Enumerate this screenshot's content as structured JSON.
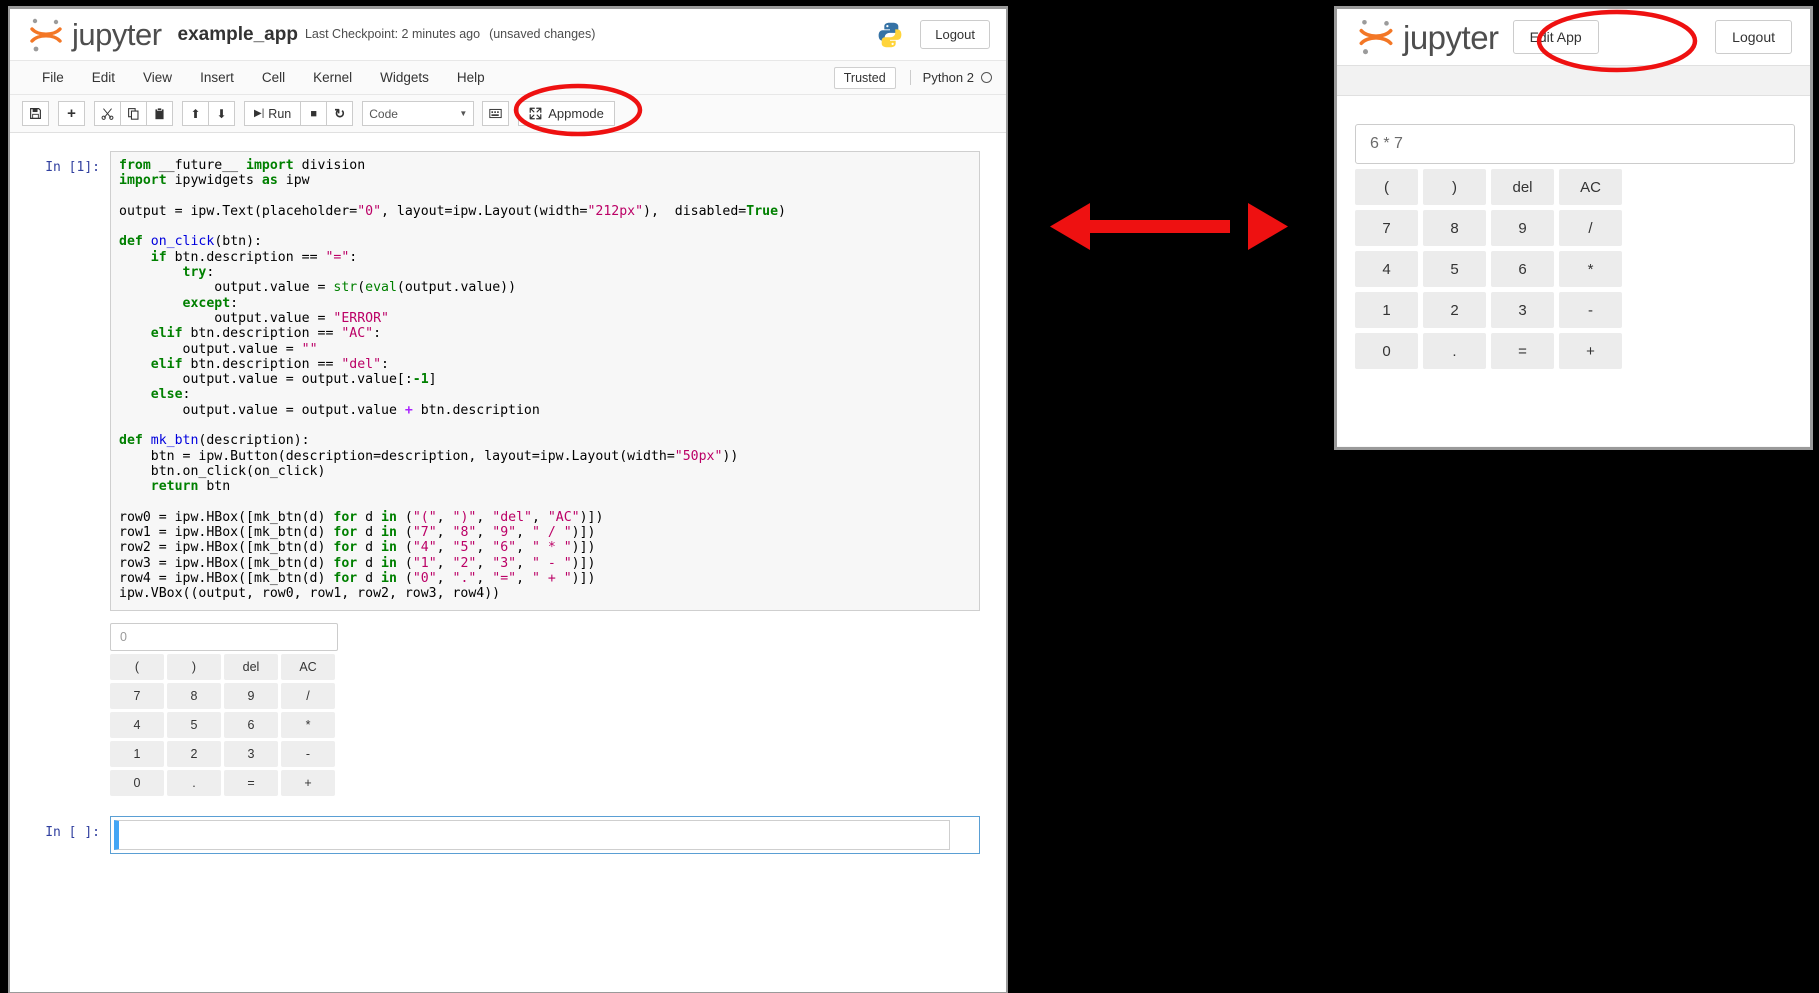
{
  "notebook": {
    "brand": "jupyter",
    "name": "example_app",
    "checkpoint": "Last Checkpoint: 2 minutes ago",
    "dirty": "(unsaved changes)",
    "logout_label": "Logout",
    "python_icon": "python-logo",
    "menus": [
      "File",
      "Edit",
      "View",
      "Insert",
      "Cell",
      "Kernel",
      "Widgets",
      "Help"
    ],
    "trusted_label": "Trusted",
    "kernel_name": "Python 2",
    "toolbar": {
      "save_icon": "save-icon",
      "add_icon": "plus-icon",
      "cut_icon": "scissors-icon",
      "copy_icon": "copy-icon",
      "paste_icon": "paste-icon",
      "move_up_icon": "arrow-up-icon",
      "move_down_icon": "arrow-down-icon",
      "run_label": "Run",
      "stop_icon": "stop-square-icon",
      "restart_icon": "restart-circle-icon",
      "celltype_value": "Code",
      "command_palette_icon": "keyboard-icon",
      "appmode_label": "Appmode",
      "appmode_icon": "expand-arrows-icon"
    },
    "cell": {
      "prompt": "In [1]:",
      "code_lines": [
        {
          "t": "from",
          "c": "k"
        }
      ]
    },
    "empty_cell_prompt": "In [ ]:"
  },
  "code": "from __future__ import division\nimport ipywidgets as ipw\n\noutput = ipw.Text(placeholder=\"0\", layout=ipw.Layout(width=\"212px\"),  disabled=True)\n\ndef on_click(btn):\n    if btn.description == \"=\":\n        try:\n            output.value = str(eval(output.value))\n        except:\n            output.value = \"ERROR\"\n    elif btn.description == \"AC\":\n        output.value = \"\"\n    elif btn.description == \"del\":\n        output.value = output.value[:-1]\n    else:\n        output.value = output.value + btn.description\n\ndef mk_btn(description):\n    btn = ipw.Button(description=description, layout=ipw.Layout(width=\"50px\"))\n    btn.on_click(on_click)\n    return btn\n\nrow0 = ipw.HBox([mk_btn(d) for d in (\"(\", \")\", \"del\", \"AC\")])\nrow1 = ipw.HBox([mk_btn(d) for d in (\"7\", \"8\", \"9\", \" / \")])\nrow2 = ipw.HBox([mk_btn(d) for d in (\"4\", \"5\", \"6\", \" * \")])\nrow3 = ipw.HBox([mk_btn(d) for d in (\"1\", \"2\", \"3\", \" - \")])\nrow4 = ipw.HBox([mk_btn(d) for d in (\"0\", \".\", \"=\", \" + \")])\nipw.VBox((output, row0, row1, row2, row3, row4))",
  "calculator_notebook": {
    "display_placeholder": "0",
    "display_value": "",
    "rows": [
      [
        "(",
        ")",
        "del",
        "AC"
      ],
      [
        "7",
        "8",
        "9",
        "/"
      ],
      [
        "4",
        "5",
        "6",
        "*"
      ],
      [
        "1",
        "2",
        "3",
        "-"
      ],
      [
        "0",
        ".",
        "=",
        "+"
      ]
    ]
  },
  "appmode": {
    "brand": "jupyter",
    "edit_app_label": "Edit App",
    "logout_label": "Logout",
    "display_value": "6 * 7",
    "rows": [
      [
        "(",
        ")",
        "del",
        "AC"
      ],
      [
        "7",
        "8",
        "9",
        "/"
      ],
      [
        "4",
        "5",
        "6",
        "*"
      ],
      [
        "1",
        "2",
        "3",
        "-"
      ],
      [
        "0",
        ".",
        "=",
        "+"
      ]
    ]
  },
  "annotations": {
    "circle_color": "#ee1111",
    "arrow_color": "#ee1111",
    "appmode_circle": "highlights-appmode-button",
    "editapp_circle": "highlights-edit-app-button",
    "arrow": "double-headed-arrow-between-views"
  }
}
